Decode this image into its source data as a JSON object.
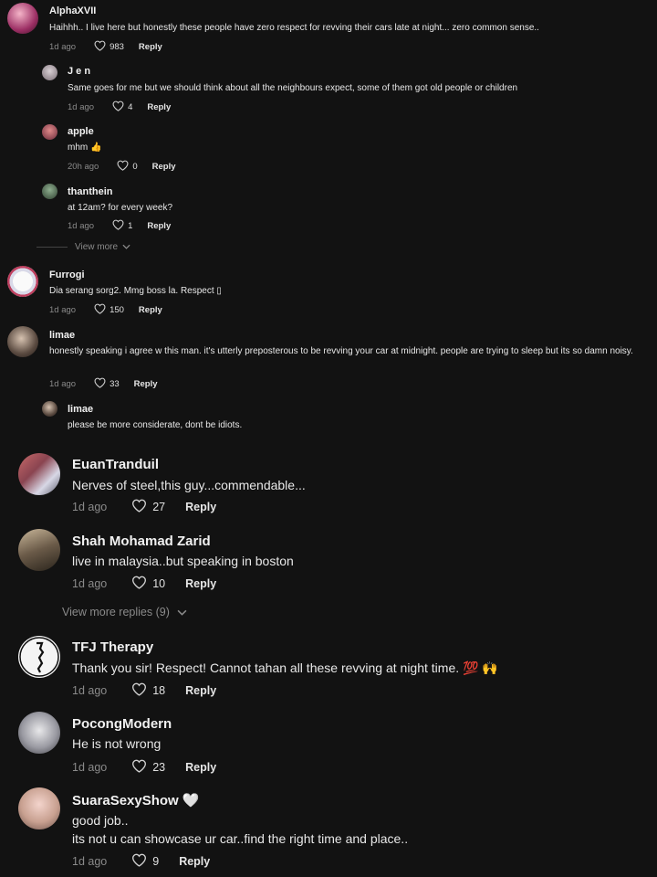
{
  "comments": [
    {
      "username": "AlphaXVII",
      "text": "Haihhh.. I live here but honestly these people have zero respect for revving their cars late at night... zero common sense..",
      "time": "1d ago",
      "likes": "983",
      "reply": "Reply"
    },
    {
      "username": "J e n",
      "text": "Same goes for me but we should think about all the neighbours expect, some of them got old people or children",
      "time": "1d ago",
      "likes": "4",
      "reply": "Reply"
    },
    {
      "username": "apple",
      "text": "mhm 👍",
      "time": "20h ago",
      "likes": "0",
      "reply": "Reply"
    },
    {
      "username": "thanthein",
      "text": "at 12am? for every week?",
      "time": "1d ago",
      "likes": "1",
      "reply": "Reply"
    },
    {
      "username": "Furrogi",
      "text": "Dia serang sorg2. Mmg boss la. Respect ▯",
      "time": "1d ago",
      "likes": "150",
      "reply": "Reply"
    },
    {
      "username": "limae",
      "text": "honestly speaking i agree w this man. it's utterly preposterous to be revving your car at midnight. people are trying to sleep but its so damn noisy.",
      "time": "1d ago",
      "likes": "33",
      "reply": "Reply"
    },
    {
      "username": "limae",
      "text": "please be more considerate, dont be idiots."
    },
    {
      "username": "EuanTranduil",
      "text": "Nerves of steel,this guy...commendable...",
      "time": "1d ago",
      "likes": "27",
      "reply": "Reply"
    },
    {
      "username": "Shah Mohamad Zarid",
      "text": "live in malaysia..but speaking in boston",
      "time": "1d ago",
      "likes": "10",
      "reply": "Reply"
    },
    {
      "username": "TFJ Therapy",
      "text": "Thank you sir! Respect! Cannot tahan all these revving at night time. 💯 🙌",
      "time": "1d ago",
      "likes": "18",
      "reply": "Reply"
    },
    {
      "username": "PocongModern",
      "text": "He is not wrong",
      "time": "1d ago",
      "likes": "23",
      "reply": "Reply"
    },
    {
      "username": "SuaraSexyShow 🤍",
      "text_lines": [
        "good job..",
        "its not u can showcase ur car..find the right time and place.."
      ],
      "time": "1d ago",
      "likes": "9",
      "reply": "Reply"
    }
  ],
  "view_more_1": "View more",
  "view_more_2": "View more replies (9)",
  "colors": {
    "background": "#121212",
    "muted": "#8a8a8a",
    "text": "#e8e8e8"
  }
}
